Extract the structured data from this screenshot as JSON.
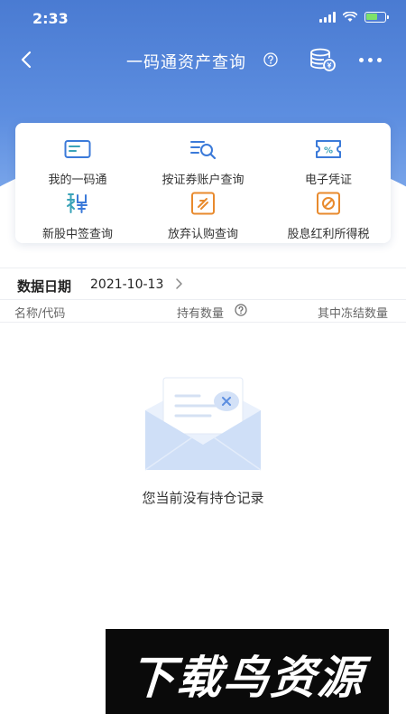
{
  "status_bar": {
    "time": "2:33"
  },
  "nav": {
    "title": "一码通资产查询"
  },
  "shortcuts": [
    {
      "label": "我的一码通",
      "icon": "card-icon"
    },
    {
      "label": "按证券账户查询",
      "icon": "list-search-icon"
    },
    {
      "label": "电子凭证",
      "icon": "percent-ticket-icon"
    },
    {
      "label": "新股中签查询",
      "icon": "new-stock-icon"
    },
    {
      "label": "放弃认购查询",
      "icon": "abandon-icon"
    },
    {
      "label": "股息红利所得税",
      "icon": "dividend-tax-icon"
    }
  ],
  "date_row": {
    "label": "数据日期",
    "value": "2021-10-13"
  },
  "table_header": {
    "name": "名称/代码",
    "holding": "持有数量",
    "frozen": "其中冻结数量"
  },
  "empty_state": {
    "message": "您当前没有持仓记录"
  },
  "watermark": {
    "text": "下载鸟资源"
  },
  "colors": {
    "header_blue": "#4a7bd2",
    "icon_blue": "#3b7ad9",
    "icon_orange": "#e88a2d",
    "icon_teal": "#3aa3b8"
  }
}
